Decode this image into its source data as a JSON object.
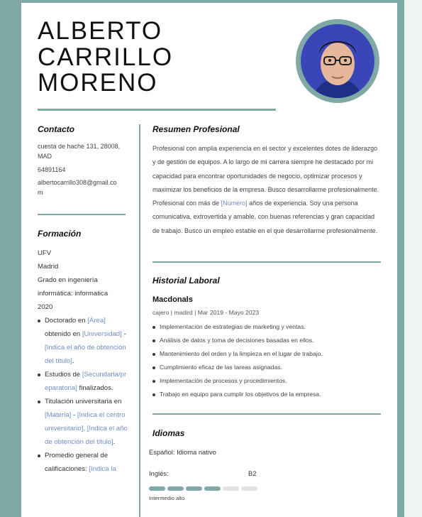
{
  "name": {
    "lines": [
      "ALBERTO",
      "CARRILLO",
      "MORENO"
    ]
  },
  "contact": {
    "heading": "Contacto",
    "address_line1": "cuesta de hache 131, 28008,",
    "address_line2": "MAD",
    "phone": "64891164",
    "email_line1": "albertocarrillo308@gmail.co",
    "email_line2": "m"
  },
  "education": {
    "heading": "Formación",
    "lines": [
      "UFV",
      "Madrid",
      "Grado en ingeniería",
      "informática: informatica",
      "2020"
    ],
    "bullets": [
      {
        "a": "Doctorado en ",
        "p1": "[Área]",
        "b": " obtenido en ",
        "p2": "[Universidad]",
        "c": " - ",
        "p3": "[Indica el año de obtención del título]",
        "d": "."
      },
      {
        "a": "Estudios de ",
        "p1": "[Secundaria/preparatoria]",
        "b": " finalizados.",
        "p2": "",
        "c": "",
        "p3": "",
        "d": ""
      },
      {
        "a": "Titulación universitaria en ",
        "p1": "[Materia]",
        "b": " - ",
        "p2": "[Indica el centro universitario]",
        "c": ". ",
        "p3": "[Indica el año de obtención del título]",
        "d": "."
      },
      {
        "a": "Promedio general de calificaciones: ",
        "p1": "[Indica la",
        "b": "",
        "p2": "",
        "c": "",
        "p3": "",
        "d": ""
      }
    ]
  },
  "summary": {
    "heading": "Resumen Profesional",
    "part1": "Profesional con amplia experiencia en el sector y excelentes dotes de liderazgo y de gestión de equipos. A lo largo de mi carrera siempre he destacado por mi capacidad para encontrar oportunidades de negocio, optimizar procesos y maximizar los beneficios de la empresa. Busco desarrollarme profesionalmente. Profesional con más de ",
    "placeholder": "[Número]",
    "part2": " años de experiencia. Soy una persona comunicativa, extrovertida y amable, con buenas referencias y gran capacidad de trabajo. Busco un empleo estable en el que desarrollarme profesionalmente."
  },
  "work": {
    "heading": "Historial Laboral",
    "company": "Macdonals",
    "meta": "cajero | madird | Mar 2019 - Mayo 2023",
    "items": [
      "Implementación de estrategias de marketing y ventas.",
      "Análisis de datos y toma de decisiones basadas en ellos.",
      "Mantenimiento del orden y la limpieza en el lugar de trabajo.",
      "Cumplimiento eficaz de las tareas asignadas.",
      "Implementación de procesos y procedimientos.",
      "Trabajo en equipo para cumplir los objetivos de la empresa."
    ]
  },
  "languages": {
    "heading": "Idiomas",
    "native": "Español: Idioma nativo",
    "english_label": "Inglés:",
    "english_level": "B2",
    "english_level_text": "Intermedio alto",
    "english_level_fraction": 0.6667
  },
  "colors": {
    "accent": "#7fa9a4",
    "placeholder_text": "#6f8fc7"
  }
}
